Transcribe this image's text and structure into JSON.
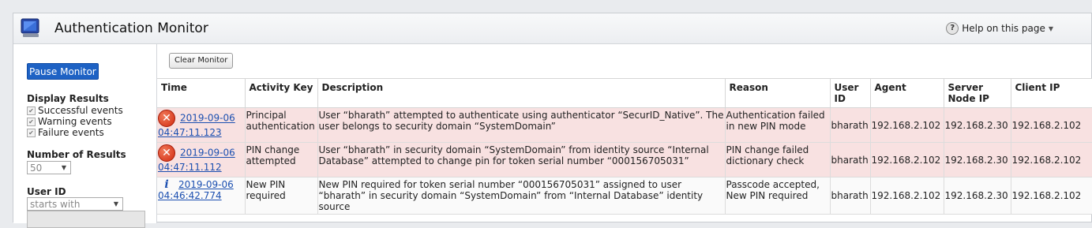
{
  "header": {
    "title": "Authentication Monitor",
    "help_label": "Help on this page"
  },
  "sidebar": {
    "pause_label": "Pause Monitor",
    "display_results_label": "Display Results",
    "display_options": [
      "Successful events",
      "Warning events",
      "Failure events"
    ],
    "number_of_results_label": "Number of Results",
    "number_of_results_value": "50",
    "user_id_label": "User ID",
    "user_id_filter_value": "starts with"
  },
  "main": {
    "clear_label": "Clear Monitor",
    "columns": [
      "Time",
      "Activity Key",
      "Description",
      "Reason",
      "User ID",
      "Agent",
      "Server Node IP",
      "Client IP"
    ],
    "rows": [
      {
        "status": "error",
        "status_icon": "error-x-icon",
        "time_date": "2019-09-06",
        "time_clock": "04:47:11.123",
        "activity_key": "Principal authentication",
        "description": "User “bharath” attempted to authenticate using authenticator “SecurID_Native”. The user belongs to security domain “SystemDomain”",
        "reason": "Authentication failed in new PIN mode",
        "user_id": "bharath",
        "agent": "192.168.2.102",
        "server_node_ip": "192.168.2.30",
        "client_ip": "192.168.2.102"
      },
      {
        "status": "error",
        "status_icon": "error-x-icon",
        "time_date": "2019-09-06",
        "time_clock": "04:47:11.112",
        "activity_key": "PIN change attempted",
        "description": "User “bharath” in security domain “SystemDomain” from identity source “Internal Database” attempted to change pin for token serial number “000156705031”",
        "reason": "PIN change failed dictionary check",
        "user_id": "bharath",
        "agent": "192.168.2.102",
        "server_node_ip": "192.168.2.30",
        "client_ip": "192.168.2.102"
      },
      {
        "status": "info",
        "status_icon": "info-icon",
        "time_date": "2019-09-06",
        "time_clock": "04:46:42.774",
        "activity_key": "New PIN required",
        "description": "New PIN required for token serial number “000156705031” assigned to user “bharath” in security domain “SystemDomain” from “Internal Database” identity source",
        "reason": "Passcode accepted, New PIN required",
        "user_id": "bharath",
        "agent": "192.168.2.102",
        "server_node_ip": "192.168.2.30",
        "client_ip": "192.168.2.102"
      }
    ]
  },
  "colors": {
    "accent": "#1e62c4",
    "error_row": "#f8e1e1",
    "link": "#1b4fb0"
  }
}
